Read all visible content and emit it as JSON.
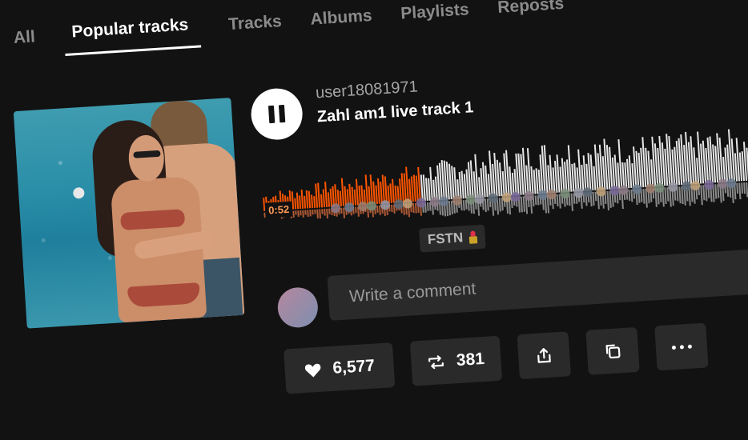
{
  "tabs": [
    {
      "label": "All"
    },
    {
      "label": "Popular tracks"
    },
    {
      "label": "Tracks"
    },
    {
      "label": "Albums"
    },
    {
      "label": "Playlists"
    },
    {
      "label": "Reposts"
    }
  ],
  "active_tab": "Popular tracks",
  "track": {
    "username": "user18081971",
    "title": "Zahl am1 live track 1",
    "elapsed": "0:52",
    "progress_fraction": 0.31,
    "comment_tag": "FSTN"
  },
  "comment": {
    "placeholder": "Write a comment"
  },
  "stats": {
    "likes": "6,577",
    "reposts": "381"
  },
  "colors": {
    "background": "#121212",
    "played": "#ff5500",
    "unplayed": "#e6e6e6",
    "button_bg": "#2a2a2a"
  },
  "icons": [
    "pause-icon",
    "heart-icon",
    "repost-icon",
    "share-icon",
    "copy-icon",
    "more-icon",
    "lipstick-icon"
  ]
}
